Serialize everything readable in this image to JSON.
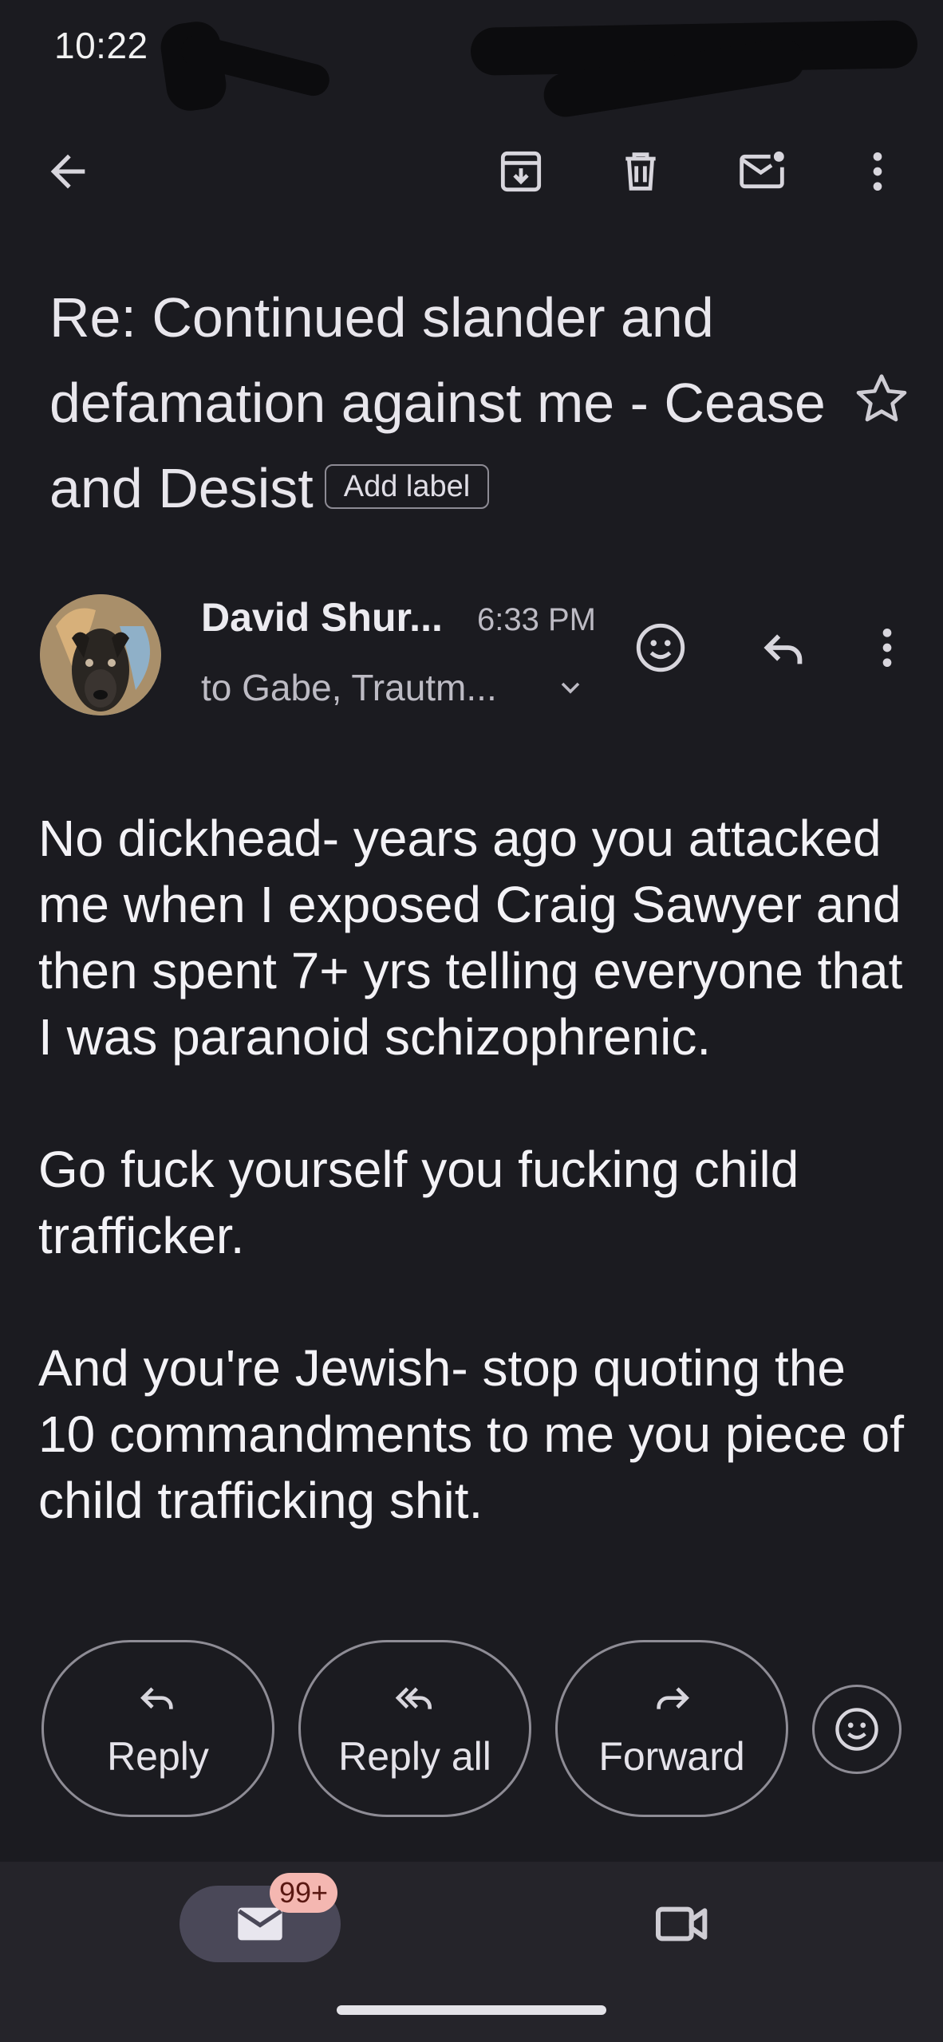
{
  "status_bar": {
    "time": "10:22"
  },
  "toolbar": {
    "back_icon": "arrow-back-icon",
    "archive_icon": "archive-icon",
    "delete_icon": "trash-icon",
    "mark_unread_icon": "mail-unread-icon",
    "more_icon": "more-vert-icon"
  },
  "email": {
    "subject": "Re: Continued slander and defamation against me - Cease and Desist",
    "add_label": "Add label",
    "sender": {
      "name": "David Shur...",
      "time": "6:33 PM",
      "recipients": "to Gabe, Trautm..."
    },
    "body": [
      "No dickhead- years ago you attacked me when I exposed Craig Sawyer and then spent 7+ yrs telling everyone that I was paranoid schizophrenic.",
      "Go fuck yourself you fucking child trafficker.",
      "And you're Jewish- stop quoting the 10 commandments to me you piece of child trafficking shit."
    ]
  },
  "actions": {
    "reply": "Reply",
    "reply_all": "Reply all",
    "forward": "Forward"
  },
  "bottom_nav": {
    "mail_badge": "99+"
  },
  "colors": {
    "background": "#1b1b20",
    "nav_background": "#25242a",
    "active_pill": "#4a4858",
    "badge": "#f4b7b1"
  }
}
